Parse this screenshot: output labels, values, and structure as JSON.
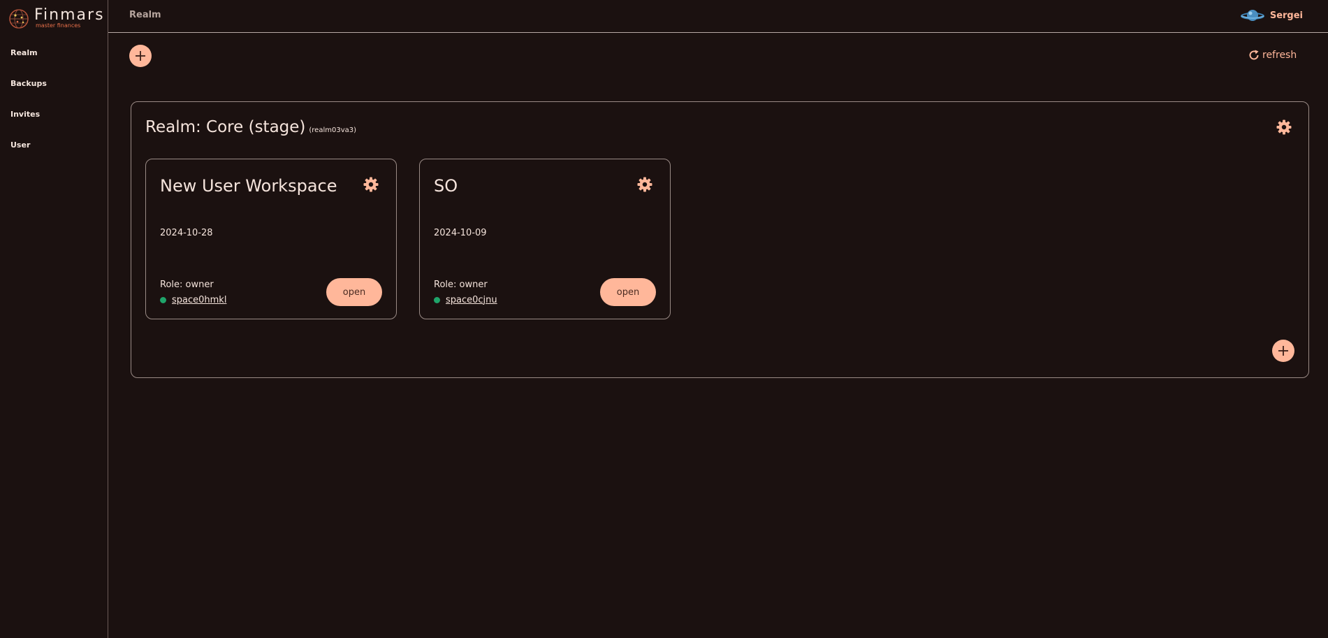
{
  "app": {
    "name": "Finmars",
    "tagline": "master finances"
  },
  "sidebar": {
    "items": [
      {
        "label": "Realm"
      },
      {
        "label": "Backups"
      },
      {
        "label": "Invites"
      },
      {
        "label": "User"
      }
    ]
  },
  "header": {
    "breadcrumb": "Realm",
    "user_name": "Sergei"
  },
  "toolbar": {
    "refresh_label": "refresh"
  },
  "realm": {
    "title": "Realm: Core (stage)",
    "code": "(realm03va3)",
    "workspaces": [
      {
        "name": "New User Workspace",
        "date": "2024-10-28",
        "role": "Role: owner",
        "space": "space0hmkl",
        "open_label": "open"
      },
      {
        "name": "SO",
        "date": "2024-10-09",
        "role": "Role: owner",
        "space": "space0cjnu",
        "open_label": "open"
      }
    ]
  },
  "colors": {
    "background": "#1b1110",
    "accent": "#ffb79a",
    "status_online": "#1fa46a"
  }
}
